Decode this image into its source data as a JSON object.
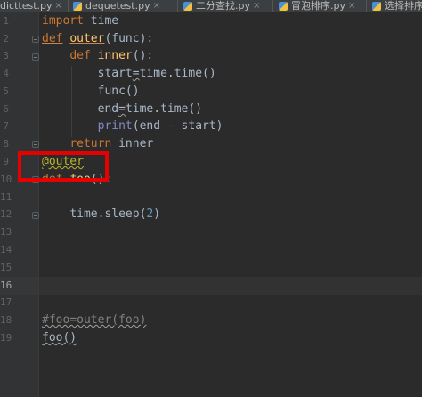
{
  "tabs": [
    {
      "label": "dicttest.py",
      "close": "×"
    },
    {
      "label": "dequetest.py",
      "close": "×"
    },
    {
      "label": "二分查找.py",
      "close": "×"
    },
    {
      "label": "冒泡排序.py",
      "close": "×"
    },
    {
      "label": "选择排序",
      "close": ""
    }
  ],
  "line_numbers": [
    "1",
    "2",
    "3",
    "4",
    "5",
    "6",
    "7",
    "8",
    "9",
    "10",
    "11",
    "12",
    "13",
    "14",
    "15",
    "16",
    "17",
    "18",
    "19"
  ],
  "active_line_number": "16",
  "code": {
    "l1": {
      "kw": "import",
      "rest": " time"
    },
    "l2": {
      "kw": "def",
      "name": "outer",
      "rest": "(func):"
    },
    "l3": {
      "indent": "    ",
      "kw": "def",
      "name": "inner",
      "rest": "():"
    },
    "l4": {
      "indent": "        ",
      "text": "start",
      "op": "=",
      "rest": "time.time()"
    },
    "l5": {
      "indent": "        ",
      "text": "func()"
    },
    "l6": {
      "indent": "        ",
      "text": "end",
      "op": "=",
      "rest": "time.time()"
    },
    "l7": {
      "indent": "        ",
      "fn": "print",
      "rest": "(end - start)"
    },
    "l8": {
      "indent": "    ",
      "kw": "return",
      "rest": " inner"
    },
    "l9": {
      "deco": "@outer"
    },
    "l10": {
      "kw": "def",
      "name": "foo",
      "rest": "():"
    },
    "l12": {
      "indent": "    ",
      "text": "time.sleep(",
      "num": "2",
      "close": ")"
    },
    "l18": {
      "comment": "#foo=outer(foo)"
    },
    "l19": {
      "text": "foo()"
    }
  },
  "colors": {
    "background": "#2b2b2b",
    "keyword": "#cc7832",
    "function": "#ffc66d",
    "number": "#6897bb",
    "decorator": "#bbb529",
    "comment": "#808080",
    "highlight_box": "#e60000"
  }
}
